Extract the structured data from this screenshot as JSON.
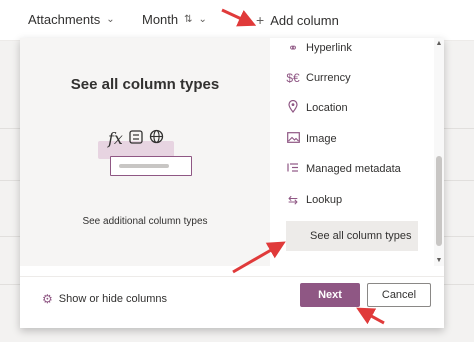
{
  "header": {
    "attachments_label": "Attachments",
    "month_label": "Month",
    "add_column_label": "Add column"
  },
  "panel": {
    "preview": {
      "title": "See all column types",
      "link_text": "See additional column types"
    },
    "column_types": [
      {
        "label": "Hyperlink",
        "icon": "link-icon"
      },
      {
        "label": "Currency",
        "icon": "currency-icon"
      },
      {
        "label": "Location",
        "icon": "location-pin-icon"
      },
      {
        "label": "Image",
        "icon": "image-icon"
      },
      {
        "label": "Managed metadata",
        "icon": "managed-metadata-icon"
      },
      {
        "label": "Lookup",
        "icon": "lookup-icon"
      },
      {
        "label": "See all column types",
        "selected": true
      }
    ],
    "footer": {
      "show_hide_label": "Show or hide columns",
      "next_label": "Next",
      "cancel_label": "Cancel"
    }
  },
  "colors": {
    "accent": "#8f5784",
    "annotation_arrow": "#e03a3a",
    "selected_bg": "#edebe9"
  }
}
